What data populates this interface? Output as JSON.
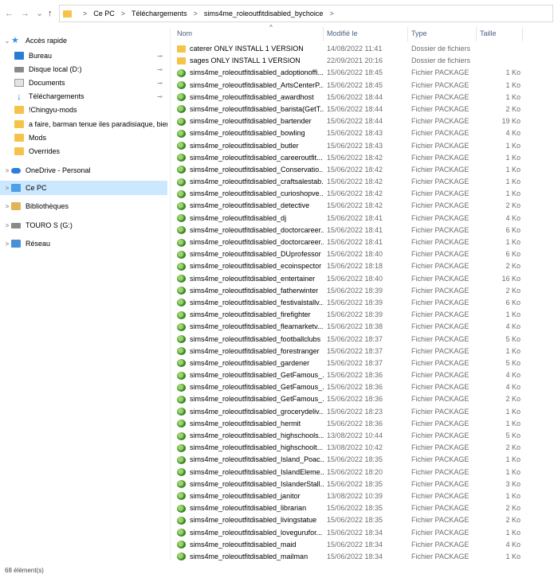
{
  "nav": {
    "back": "←",
    "forward": "→",
    "recent": "⌄",
    "up": "↑"
  },
  "address": {
    "crumbs": [
      "Ce PC",
      "Téléchargements",
      "sims4me_roleoutfitdisabled_bychoice"
    ],
    "separator": ">"
  },
  "sidebar": {
    "items": [
      {
        "label": "Accès rapide",
        "icon": "star-icon",
        "chev": "⌄",
        "pinned": false
      },
      {
        "label": "Bureau",
        "icon": "desktop-icon",
        "chev": "",
        "pinned": true
      },
      {
        "label": "Disque local (D:)",
        "icon": "drive-icon",
        "chev": "",
        "pinned": true
      },
      {
        "label": "Documents",
        "icon": "documents-icon",
        "chev": "",
        "pinned": true
      },
      {
        "label": "Téléchargements",
        "icon": "download-icon",
        "chev": "",
        "pinned": true
      },
      {
        "label": "!Chingyu-mods",
        "icon": "folder-icon",
        "chev": "",
        "pinned": false
      },
      {
        "label": "a faire, barman tenue iles paradisiaque, biens",
        "icon": "folder-icon",
        "chev": "",
        "pinned": false
      },
      {
        "label": "Mods",
        "icon": "folder-icon",
        "chev": "",
        "pinned": false
      },
      {
        "label": "Overrides",
        "icon": "folder-icon",
        "chev": "",
        "pinned": false
      },
      {
        "label": "OneDrive - Personal",
        "icon": "cloud-icon",
        "chev": ">",
        "pinned": false
      },
      {
        "label": "Ce PC",
        "icon": "pc-icon",
        "chev": ">",
        "pinned": false
      },
      {
        "label": "Bibliothèques",
        "icon": "library-icon",
        "chev": ">",
        "pinned": false
      },
      {
        "label": "TOURO S (G:)",
        "icon": "drive-icon",
        "chev": ">",
        "pinned": false
      },
      {
        "label": "Réseau",
        "icon": "network-icon",
        "chev": ">",
        "pinned": false
      }
    ],
    "pin_glyph": "📌"
  },
  "columns": {
    "name": "Nom",
    "date": "Modifié le",
    "type": "Type",
    "size": "Taille",
    "sort_glyph": "^"
  },
  "files": [
    {
      "name": "caterer ONLY INSTALL 1 VERSION",
      "date": "14/08/2022 11:41",
      "type": "Dossier de fichiers",
      "size": "",
      "kind": "folder"
    },
    {
      "name": "sages ONLY INSTALL 1 VERSION",
      "date": "22/09/2021 20:16",
      "type": "Dossier de fichiers",
      "size": "",
      "kind": "folder"
    },
    {
      "name": "sims4me_roleoutfitdisabled_adoptionoffi...",
      "date": "15/06/2022 18:45",
      "type": "Fichier PACKAGE",
      "size": "1 Ko",
      "kind": "package"
    },
    {
      "name": "sims4me_roleoutfitdisabled_ArtsCenterP...",
      "date": "15/06/2022 18:45",
      "type": "Fichier PACKAGE",
      "size": "1 Ko",
      "kind": "package"
    },
    {
      "name": "sims4me_roleoutfitdisabled_awardhost",
      "date": "15/06/2022 18:44",
      "type": "Fichier PACKAGE",
      "size": "1 Ko",
      "kind": "package"
    },
    {
      "name": "sims4me_roleoutfitdisabled_barista(GetT...",
      "date": "15/06/2022 18:44",
      "type": "Fichier PACKAGE",
      "size": "2 Ko",
      "kind": "package"
    },
    {
      "name": "sims4me_roleoutfitdisabled_bartender",
      "date": "15/06/2022 18:44",
      "type": "Fichier PACKAGE",
      "size": "19 Ko",
      "kind": "package"
    },
    {
      "name": "sims4me_roleoutfitdisabled_bowling",
      "date": "15/06/2022 18:43",
      "type": "Fichier PACKAGE",
      "size": "4 Ko",
      "kind": "package"
    },
    {
      "name": "sims4me_roleoutfitdisabled_butler",
      "date": "15/06/2022 18:43",
      "type": "Fichier PACKAGE",
      "size": "1 Ko",
      "kind": "package"
    },
    {
      "name": "sims4me_roleoutfitdisabled_careeroutfit...",
      "date": "15/06/2022 18:42",
      "type": "Fichier PACKAGE",
      "size": "1 Ko",
      "kind": "package"
    },
    {
      "name": "sims4me_roleoutfitdisabled_Conservatio...",
      "date": "15/06/2022 18:42",
      "type": "Fichier PACKAGE",
      "size": "1 Ko",
      "kind": "package"
    },
    {
      "name": "sims4me_roleoutfitdisabled_craftsalestab...",
      "date": "15/06/2022 18:42",
      "type": "Fichier PACKAGE",
      "size": "1 Ko",
      "kind": "package"
    },
    {
      "name": "sims4me_roleoutfitdisabled_curioshopve...",
      "date": "15/06/2022 18:42",
      "type": "Fichier PACKAGE",
      "size": "1 Ko",
      "kind": "package"
    },
    {
      "name": "sims4me_roleoutfitdisabled_detective",
      "date": "15/06/2022 18:42",
      "type": "Fichier PACKAGE",
      "size": "2 Ko",
      "kind": "package"
    },
    {
      "name": "sims4me_roleoutfitdisabled_dj",
      "date": "15/06/2022 18:41",
      "type": "Fichier PACKAGE",
      "size": "4 Ko",
      "kind": "package"
    },
    {
      "name": "sims4me_roleoutfitdisabled_doctorcareer...",
      "date": "15/06/2022 18:41",
      "type": "Fichier PACKAGE",
      "size": "6 Ko",
      "kind": "package"
    },
    {
      "name": "sims4me_roleoutfitdisabled_doctorcareer...",
      "date": "15/06/2022 18:41",
      "type": "Fichier PACKAGE",
      "size": "1 Ko",
      "kind": "package"
    },
    {
      "name": "sims4me_roleoutfitdisabled_DUprofessor",
      "date": "15/06/2022 18:40",
      "type": "Fichier PACKAGE",
      "size": "6 Ko",
      "kind": "package"
    },
    {
      "name": "sims4me_roleoutfitdisabled_ecoinspector",
      "date": "15/06/2022 18:18",
      "type": "Fichier PACKAGE",
      "size": "2 Ko",
      "kind": "package"
    },
    {
      "name": "sims4me_roleoutfitdisabled_entertainer",
      "date": "15/06/2022 18:40",
      "type": "Fichier PACKAGE",
      "size": "16 Ko",
      "kind": "package"
    },
    {
      "name": "sims4me_roleoutfitdisabled_fatherwinter",
      "date": "15/06/2022 18:39",
      "type": "Fichier PACKAGE",
      "size": "2 Ko",
      "kind": "package"
    },
    {
      "name": "sims4me_roleoutfitdisabled_festivalstallv...",
      "date": "15/06/2022 18:39",
      "type": "Fichier PACKAGE",
      "size": "6 Ko",
      "kind": "package"
    },
    {
      "name": "sims4me_roleoutfitdisabled_firefighter",
      "date": "15/06/2022 18:39",
      "type": "Fichier PACKAGE",
      "size": "1 Ko",
      "kind": "package"
    },
    {
      "name": "sims4me_roleoutfitdisabled_fleamarketv...",
      "date": "15/06/2022 18:38",
      "type": "Fichier PACKAGE",
      "size": "4 Ko",
      "kind": "package"
    },
    {
      "name": "sims4me_roleoutfitdisabled_footballclubs",
      "date": "15/06/2022 18:37",
      "type": "Fichier PACKAGE",
      "size": "5 Ko",
      "kind": "package"
    },
    {
      "name": "sims4me_roleoutfitdisabled_forestranger",
      "date": "15/06/2022 18:37",
      "type": "Fichier PACKAGE",
      "size": "1 Ko",
      "kind": "package"
    },
    {
      "name": "sims4me_roleoutfitdisabled_gardener",
      "date": "15/06/2022 18:37",
      "type": "Fichier PACKAGE",
      "size": "5 Ko",
      "kind": "package"
    },
    {
      "name": "sims4me_roleoutfitdisabled_GetFamous_...",
      "date": "15/06/2022 18:36",
      "type": "Fichier PACKAGE",
      "size": "4 Ko",
      "kind": "package"
    },
    {
      "name": "sims4me_roleoutfitdisabled_GetFamous_...",
      "date": "15/06/2022 18:36",
      "type": "Fichier PACKAGE",
      "size": "4 Ko",
      "kind": "package"
    },
    {
      "name": "sims4me_roleoutfitdisabled_GetFamous_...",
      "date": "15/06/2022 18:36",
      "type": "Fichier PACKAGE",
      "size": "2 Ko",
      "kind": "package"
    },
    {
      "name": "sims4me_roleoutfitdisabled_grocerydeliv...",
      "date": "15/06/2022 18:23",
      "type": "Fichier PACKAGE",
      "size": "1 Ko",
      "kind": "package"
    },
    {
      "name": "sims4me_roleoutfitdisabled_hermit",
      "date": "15/06/2022 18:36",
      "type": "Fichier PACKAGE",
      "size": "1 Ko",
      "kind": "package"
    },
    {
      "name": "sims4me_roleoutfitdisabled_highschools...",
      "date": "13/08/2022 10:44",
      "type": "Fichier PACKAGE",
      "size": "5 Ko",
      "kind": "package"
    },
    {
      "name": "sims4me_roleoutfitdisabled_highschoolt...",
      "date": "13/08/2022 10:42",
      "type": "Fichier PACKAGE",
      "size": "2 Ko",
      "kind": "package"
    },
    {
      "name": "sims4me_roleoutfitdisabled_Island_Poac...",
      "date": "15/06/2022 18:35",
      "type": "Fichier PACKAGE",
      "size": "1 Ko",
      "kind": "package"
    },
    {
      "name": "sims4me_roleoutfitdisabled_IslandEleme...",
      "date": "15/06/2022 18:20",
      "type": "Fichier PACKAGE",
      "size": "1 Ko",
      "kind": "package"
    },
    {
      "name": "sims4me_roleoutfitdisabled_IslanderStall...",
      "date": "15/06/2022 18:35",
      "type": "Fichier PACKAGE",
      "size": "3 Ko",
      "kind": "package"
    },
    {
      "name": "sims4me_roleoutfitdisabled_janitor",
      "date": "13/08/2022 10:39",
      "type": "Fichier PACKAGE",
      "size": "1 Ko",
      "kind": "package"
    },
    {
      "name": "sims4me_roleoutfitdisabled_librarian",
      "date": "15/06/2022 18:35",
      "type": "Fichier PACKAGE",
      "size": "2 Ko",
      "kind": "package"
    },
    {
      "name": "sims4me_roleoutfitdisabled_livingstatue",
      "date": "15/06/2022 18:35",
      "type": "Fichier PACKAGE",
      "size": "2 Ko",
      "kind": "package"
    },
    {
      "name": "sims4me_roleoutfitdisabled_lovegurufor...",
      "date": "15/06/2022 18:34",
      "type": "Fichier PACKAGE",
      "size": "1 Ko",
      "kind": "package"
    },
    {
      "name": "sims4me_roleoutfitdisabled_maid",
      "date": "15/06/2022 18:34",
      "type": "Fichier PACKAGE",
      "size": "4 Ko",
      "kind": "package"
    },
    {
      "name": "sims4me_roleoutfitdisabled_mailman",
      "date": "15/06/2022 18:34",
      "type": "Fichier PACKAGE",
      "size": "1 Ko",
      "kind": "package"
    }
  ],
  "status": {
    "text": "68 élément(s)"
  }
}
